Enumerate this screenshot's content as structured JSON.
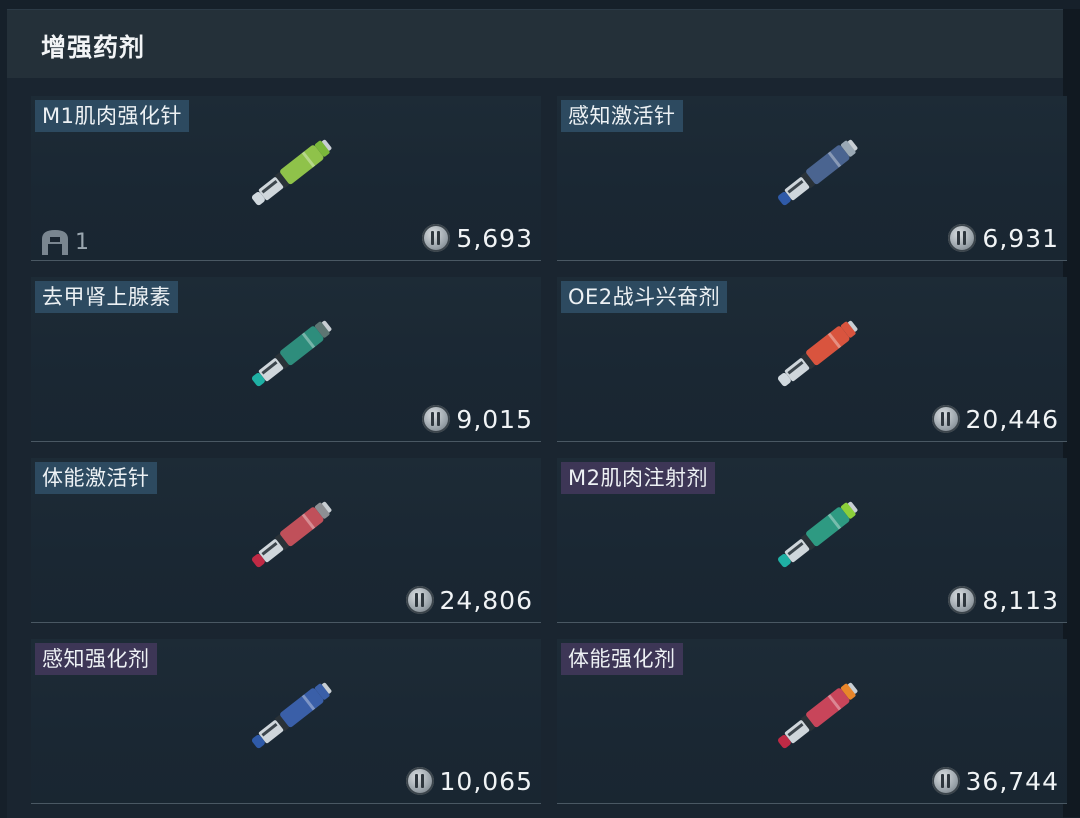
{
  "header": {
    "title": "增强药剂"
  },
  "items": [
    {
      "name": "M1肌肉强化针",
      "price": "5,693",
      "stock": "1",
      "tag_color": "#2d4a60",
      "icon": "syringe-icon",
      "colors": {
        "body": "#8fc24a",
        "cap": "#7ab83a",
        "tip": "#d0d8de"
      }
    },
    {
      "name": "感知激活针",
      "price": "6,931",
      "stock": "",
      "tag_color": "#2d4a60",
      "icon": "syringe-icon",
      "colors": {
        "body": "#4a6490",
        "cap": "#9aa8b4",
        "tip": "#2f5aa8"
      }
    },
    {
      "name": "去甲肾上腺素",
      "price": "9,015",
      "stock": "",
      "tag_color": "#2d4a60",
      "icon": "syringe-icon",
      "colors": {
        "body": "#2e8d7c",
        "cap": "#5d7572",
        "tip": "#1fb0a4"
      }
    },
    {
      "name": "OE2战斗兴奋剂",
      "price": "20,446",
      "stock": "",
      "tag_color": "#2d4a60",
      "icon": "syringe-icon",
      "colors": {
        "body": "#d9543e",
        "cap": "#d9543e",
        "tip": "#d0d8de"
      }
    },
    {
      "name": "体能激活针",
      "price": "24,806",
      "stock": "",
      "tag_color": "#2d4a60",
      "icon": "syringe-icon",
      "colors": {
        "body": "#c0505a",
        "cap": "#8d8f93",
        "tip": "#c02a45"
      }
    },
    {
      "name": "M2肌肉注射剂",
      "price": "8,113",
      "stock": "",
      "tag_color": "#3d3656",
      "icon": "syringe-icon",
      "colors": {
        "body": "#2e9a82",
        "cap": "#8ccf3a",
        "tip": "#1fb0a4"
      }
    },
    {
      "name": "感知强化剂",
      "price": "10,065",
      "stock": "",
      "tag_color": "#3d3656",
      "icon": "syringe-icon",
      "colors": {
        "body": "#3a5fa8",
        "cap": "#3a5fa8",
        "tip": "#2f5aa8"
      }
    },
    {
      "name": "体能强化剂",
      "price": "36,744",
      "stock": "",
      "tag_color": "#3d3656",
      "icon": "syringe-icon",
      "colors": {
        "body": "#c8455a",
        "cap": "#e8862a",
        "tip": "#c02a45"
      }
    }
  ]
}
